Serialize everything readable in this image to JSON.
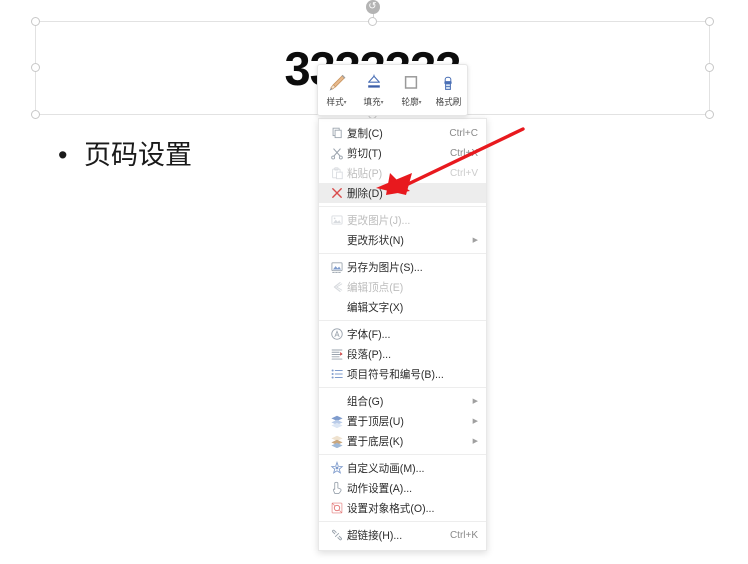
{
  "slide": {
    "title_text": "3333333",
    "body_bullet": "•",
    "body_text": "页码设置",
    "rotate_handle_glyph": "↺"
  },
  "mini_toolbar": {
    "buttons": [
      {
        "label": "样式",
        "icon": "brush-icon",
        "caret": "▾"
      },
      {
        "label": "填充",
        "icon": "fill-bucket-icon",
        "caret": "▾"
      },
      {
        "label": "轮廓",
        "icon": "outline-square-icon",
        "caret": "▾"
      },
      {
        "label": "格式刷",
        "icon": "format-painter-icon",
        "caret": ""
      }
    ]
  },
  "context_menu": {
    "items": [
      {
        "label": "复制(C)",
        "shortcut": "Ctrl+C",
        "icon": "copy-icon",
        "disabled": false,
        "highlighted": false,
        "submenu": false
      },
      {
        "label": "剪切(T)",
        "shortcut": "Ctrl+X",
        "icon": "scissors-icon",
        "disabled": false,
        "highlighted": false,
        "submenu": false
      },
      {
        "label": "粘贴(P)",
        "shortcut": "Ctrl+V",
        "icon": "paste-icon",
        "disabled": true,
        "highlighted": false,
        "submenu": false
      },
      {
        "label": "删除(D)",
        "shortcut": "",
        "icon": "delete-x-icon",
        "disabled": false,
        "highlighted": true,
        "submenu": false
      },
      {
        "label": "更改图片(J)...",
        "shortcut": "",
        "icon": "change-picture-icon",
        "disabled": true,
        "highlighted": false,
        "submenu": false
      },
      {
        "label": "更改形状(N)",
        "shortcut": "",
        "icon": "",
        "disabled": false,
        "highlighted": false,
        "submenu": true
      },
      {
        "label": "另存为图片(S)...",
        "shortcut": "",
        "icon": "save-image-icon",
        "disabled": false,
        "highlighted": false,
        "submenu": false
      },
      {
        "label": "编辑顶点(E)",
        "shortcut": "",
        "icon": "edit-vertex-icon",
        "disabled": true,
        "highlighted": false,
        "submenu": false
      },
      {
        "label": "编辑文字(X)",
        "shortcut": "",
        "icon": "",
        "disabled": false,
        "highlighted": false,
        "submenu": false
      },
      {
        "label": "字体(F)...",
        "shortcut": "",
        "icon": "font-icon",
        "disabled": false,
        "highlighted": false,
        "submenu": false
      },
      {
        "label": "段落(P)...",
        "shortcut": "",
        "icon": "paragraph-icon",
        "disabled": false,
        "highlighted": false,
        "submenu": false
      },
      {
        "label": "项目符号和编号(B)...",
        "shortcut": "",
        "icon": "bullets-icon",
        "disabled": false,
        "highlighted": false,
        "submenu": false
      },
      {
        "label": "组合(G)",
        "shortcut": "",
        "icon": "",
        "disabled": false,
        "highlighted": false,
        "submenu": true
      },
      {
        "label": "置于顶层(U)",
        "shortcut": "",
        "icon": "bring-front-icon",
        "disabled": false,
        "highlighted": false,
        "submenu": true
      },
      {
        "label": "置于底层(K)",
        "shortcut": "",
        "icon": "send-back-icon",
        "disabled": false,
        "highlighted": false,
        "submenu": true
      },
      {
        "label": "自定义动画(M)...",
        "shortcut": "",
        "icon": "animation-icon",
        "disabled": false,
        "highlighted": false,
        "submenu": false
      },
      {
        "label": "动作设置(A)...",
        "shortcut": "",
        "icon": "action-settings-icon",
        "disabled": false,
        "highlighted": false,
        "submenu": false
      },
      {
        "label": "设置对象格式(O)...",
        "shortcut": "",
        "icon": "format-object-icon",
        "disabled": false,
        "highlighted": false,
        "submenu": false
      },
      {
        "label": "超链接(H)...",
        "shortcut": "Ctrl+K",
        "icon": "hyperlink-icon",
        "disabled": false,
        "highlighted": false,
        "submenu": false
      }
    ],
    "separator_after_indices": [
      3,
      5,
      8,
      11,
      14,
      17
    ],
    "submenu_arrow_glyph": "▶"
  },
  "annotation": {
    "arrow_color": "#E8191E",
    "arrow_name": "red-pointer-arrow"
  },
  "colors": {
    "highlight_bg": "#EDEDED",
    "menu_border": "#E8E8E8",
    "selection_border": "#E2E2E2",
    "handle_border": "#C8C8C8",
    "text_primary": "#2B2B2B",
    "text_disabled": "#BDBDBD",
    "shortcut_text": "#8A8A8A"
  }
}
